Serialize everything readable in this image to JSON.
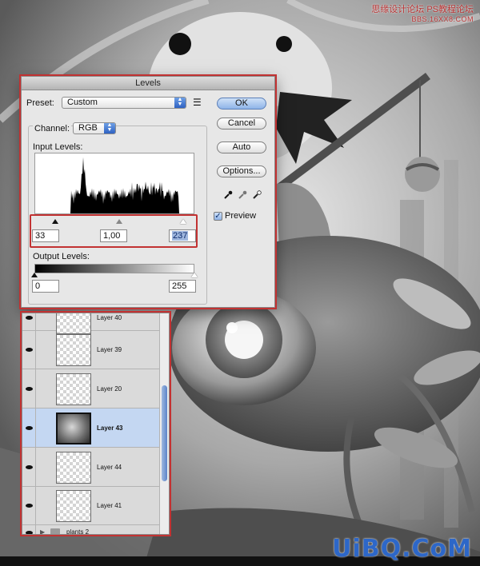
{
  "watermark": {
    "top_line": "思缘设计论坛",
    "top_sub": "BBS.16XX8.COM",
    "top_right": "PS教程论坛",
    "bottom": "UiBQ.CoM"
  },
  "levels": {
    "title": "Levels",
    "preset_label": "Preset:",
    "preset_value": "Custom",
    "channel_label": "Channel:",
    "channel_value": "RGB",
    "input_label": "Input Levels:",
    "input_black": "33",
    "input_gamma": "1,00",
    "input_white": "237",
    "output_label": "Output Levels:",
    "output_black": "0",
    "output_white": "255",
    "buttons": {
      "ok": "OK",
      "cancel": "Cancel",
      "auto": "Auto",
      "options": "Options..."
    },
    "preview_label": "Preview",
    "preview_checked": "✓",
    "input_black_level": 33,
    "input_gamma_level": 1.0,
    "input_white_level": 237,
    "output_black_level": 0,
    "output_white_level": 255
  },
  "layers": [
    {
      "name": "Layer 40",
      "active": false
    },
    {
      "name": "Layer 39",
      "active": false
    },
    {
      "name": "Layer 20",
      "active": false
    },
    {
      "name": "Layer 43",
      "active": true
    },
    {
      "name": "Layer 44",
      "active": false
    },
    {
      "name": "Layer 41",
      "active": false
    },
    {
      "name": "plants 2",
      "active": false
    }
  ]
}
